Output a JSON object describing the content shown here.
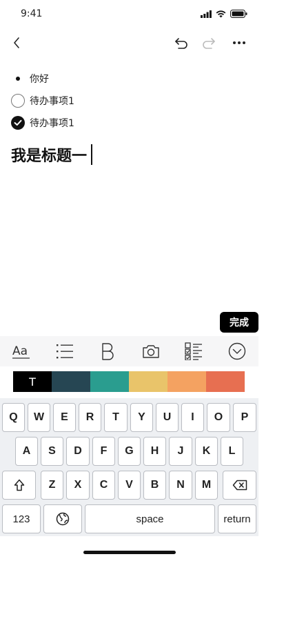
{
  "status_bar": {
    "time": "9:41"
  },
  "content": {
    "bullet_item": "你好",
    "todo_items": [
      {
        "label": "待办事项1",
        "checked": false
      },
      {
        "label": "待办事项1",
        "checked": true
      }
    ],
    "heading": "我是标题一"
  },
  "done_label": "完成",
  "toolbar_icons": [
    "text-style-icon",
    "list-icon",
    "bold-icon",
    "camera-icon",
    "checklist-icon",
    "collapse-icon"
  ],
  "color_swatches": {
    "text_symbol": "T",
    "colors": [
      "#000000",
      "#264653",
      "#2a9d8f",
      "#e9c46a",
      "#f4a261",
      "#e76f51"
    ]
  },
  "keyboard": {
    "row1": [
      "Q",
      "W",
      "E",
      "R",
      "T",
      "Y",
      "U",
      "I",
      "O",
      "P"
    ],
    "row2": [
      "A",
      "S",
      "D",
      "F",
      "G",
      "H",
      "J",
      "K",
      "L"
    ],
    "row3": [
      "Z",
      "X",
      "C",
      "V",
      "B",
      "N",
      "M"
    ],
    "numbers_key": "123",
    "space_key": "space",
    "return_key": "return"
  }
}
